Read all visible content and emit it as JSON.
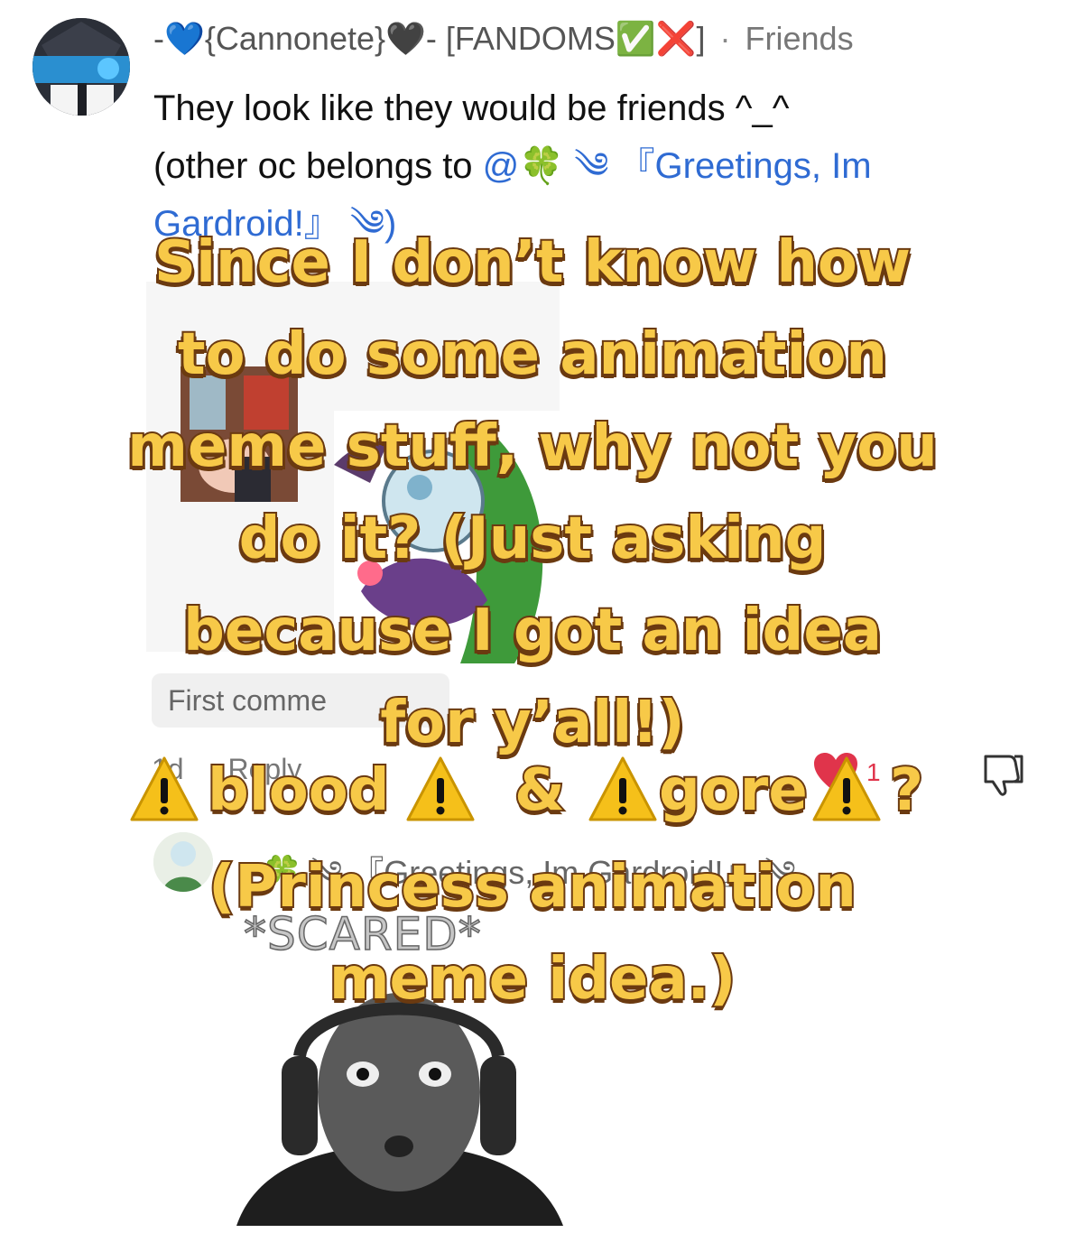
{
  "comment": {
    "author": "-💙{Cannonete}🖤- [FANDOMS✅❌]",
    "separator": "·",
    "relation": "Friends",
    "line1": "They look like they would be friends ^_^",
    "line2_prefix": "(other oc belongs to ",
    "mention": "@🍀 ༄ 『Greetings, Im Gardroid!』 ༄)",
    "first_comment_placeholder": "First comme",
    "time": "1d",
    "reply_label": "Reply",
    "like_count": "1"
  },
  "reply": {
    "author": "🍀 ༄ 『Greetings, Im Gardroid!』 ༄"
  },
  "overlay": {
    "lines": [
      "Since I don’t know how",
      "to do some animation",
      "meme stuff, why not you",
      "do it? (Just asking",
      "because I got an idea",
      "for y’all!)"
    ],
    "warn_blood": "blood",
    "warn_amp": "&",
    "warn_gore": "gore",
    "warn_q": "?",
    "lines2": [
      "(Princess animation",
      "meme idea.)"
    ]
  },
  "meme": {
    "caption": "*SCARED*"
  },
  "colors": {
    "overlay_fill": "#f7c948",
    "overlay_stroke": "#6b3a10",
    "mention": "#2f6bd3",
    "heart": "#e0344b"
  }
}
